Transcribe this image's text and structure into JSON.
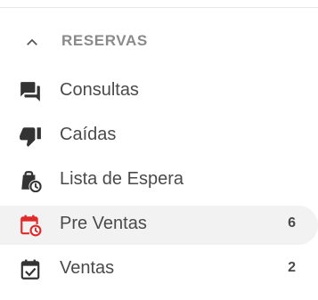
{
  "section": {
    "title": "RESERVAS",
    "icon": "chevron-up-icon",
    "expanded": true
  },
  "items": [
    {
      "label": "Consultas",
      "icon": "forum-icon",
      "count": "",
      "active": false
    },
    {
      "label": "Caídas",
      "icon": "thumb-down-icon",
      "count": "",
      "active": false
    },
    {
      "label": "Lista de Espera",
      "icon": "bag-clock-icon",
      "count": "",
      "active": false
    },
    {
      "label": "Pre Ventas",
      "icon": "calendar-clock-icon",
      "count": "6",
      "active": true
    },
    {
      "label": "Ventas",
      "icon": "calendar-check-icon",
      "count": "2",
      "active": false
    }
  ],
  "colors": {
    "icon_default": "#333333",
    "icon_active": "#e02a2a",
    "text": "#4a4a4a",
    "section_title": "#8a8a8a",
    "active_bg": "#f2f2f2"
  }
}
